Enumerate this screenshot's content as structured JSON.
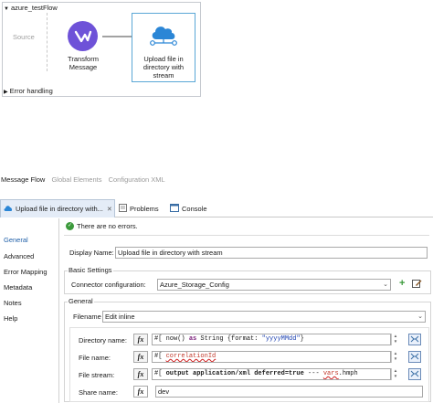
{
  "flow": {
    "title": "azure_testFlow",
    "source_label": "Source",
    "transform_label_line1": "Transform",
    "transform_label_line2": "Message",
    "upload_label_line1": "Upload file in",
    "upload_label_line2": "directory with",
    "upload_label_line3": "stream",
    "error_handling": "Error handling"
  },
  "message_flow_tabs": {
    "message_flow": "Message Flow",
    "global_elements": "Global Elements",
    "configuration_xml": "Configuration XML"
  },
  "editor_tabs": {
    "active": "Upload file in directory with...",
    "problems": "Problems",
    "console": "Console"
  },
  "left_nav": [
    "General",
    "Advanced",
    "Error Mapping",
    "Metadata",
    "Notes",
    "Help"
  ],
  "status": "There are no errors.",
  "form": {
    "display_name_label": "Display Name:",
    "display_name_value": "Upload file in directory with stream",
    "basic_settings_title": "Basic Settings",
    "connector_config_label": "Connector configuration:",
    "connector_config_value": "Azure_Storage_Config",
    "general_title": "General",
    "filename_label": "Filename",
    "filename_value": "Edit inline",
    "directory_label": "Directory name:",
    "directory_expr_prefix": "#[ now() ",
    "directory_expr_kw": "as",
    "directory_expr_mid": " String {format: ",
    "directory_expr_str": "\"yyyyMMdd\"",
    "directory_expr_end": "}",
    "file_name_label": "File name:",
    "file_name_prefix": "#[ ",
    "file_name_var": "correlationId",
    "file_stream_label": "File stream:",
    "file_stream_prefix": "#[ ",
    "file_stream_kw": "output application/xml deferred=true",
    "file_stream_mid": " --- ",
    "file_stream_var": "vars",
    "file_stream_end": ".hmph",
    "share_name_label": "Share name:",
    "share_name_value": "dev"
  },
  "colors": {
    "transform_purple": "#6e52d8",
    "azure_blue": "#2b86d6",
    "ok_green": "#3c9a3c",
    "selection_blue": "#1f5fa8"
  }
}
